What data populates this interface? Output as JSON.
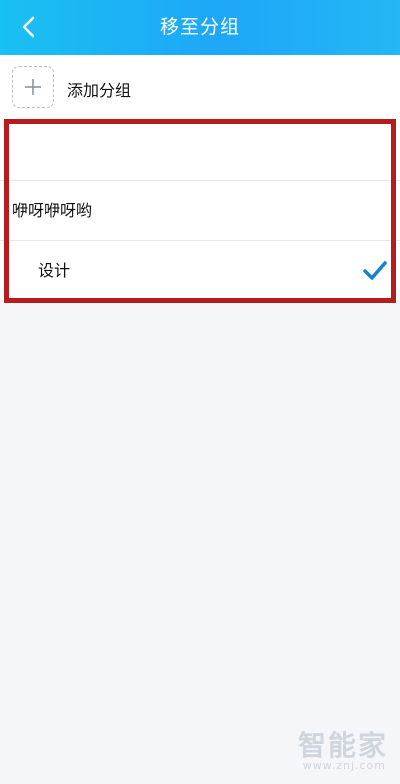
{
  "header": {
    "title": "移至分组",
    "back_icon": "back-chevron-icon",
    "gradient_start": "#19c0f2",
    "gradient_end": "#23b7f6"
  },
  "add_group": {
    "label": "添加分组",
    "icon": "plus-icon"
  },
  "groups": [
    {
      "label": "",
      "selected": false
    },
    {
      "label": "咿呀咿呀哟",
      "selected": false
    },
    {
      "label": "设计",
      "selected": true
    }
  ],
  "colors": {
    "highlight": "#b71c1c",
    "check": "#1a7fd1",
    "background": "#f4f6fa"
  },
  "watermark": {
    "main": "智能家",
    "sub": "www.znj.com"
  }
}
